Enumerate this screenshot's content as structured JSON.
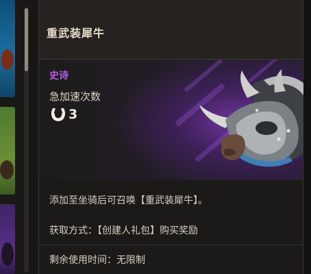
{
  "tooltip": {
    "title": "重武装犀牛",
    "rarity": "史诗",
    "stat_label": "急加速次数",
    "stat_icon": "horseshoe-icon",
    "stat_value": "3",
    "description": "添加至坐骑后可召唤【重武装犀牛】。",
    "obtain": "获取方式：【创建人礼包】购买奖励",
    "remaining_time": "剩余使用时间：无限制"
  },
  "colors": {
    "rarity_epic": "#b25de6",
    "title": "#e6dccb",
    "panel_bg": "#1c1a18",
    "header_bg": "#25221f"
  }
}
